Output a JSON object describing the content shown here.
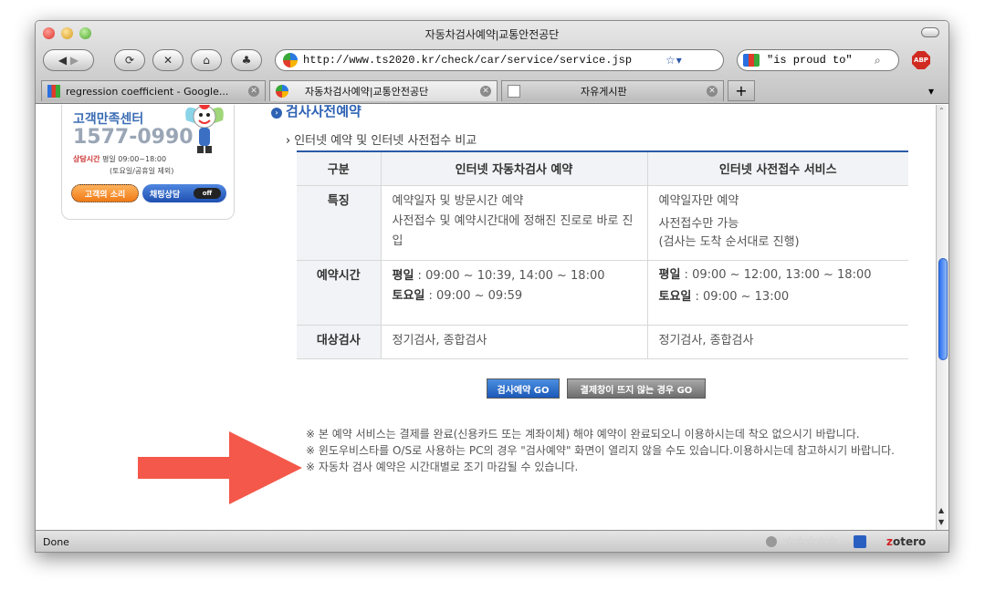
{
  "window": {
    "title": "자동차검사예약|교통안전공단"
  },
  "toolbar": {
    "url": "http://www.ts2020.kr/check/car/service/service.jsp",
    "search_value": "\"is proud to\"",
    "abp_label": "ABP"
  },
  "tabs": [
    {
      "label": "regression coefficient - Google..."
    },
    {
      "label": "자동차검사예약|교통안전공단"
    },
    {
      "label": "자유게시판"
    }
  ],
  "sidebar": {
    "title": "고객만족센터",
    "phone": "1577-0990",
    "hours_label": "상담시간",
    "hours": "평일 09:00~18:00",
    "holiday": "(토요일/공휴일 제외)",
    "voice_button": "고객의 소리",
    "chat_button": "채팅상담",
    "chat_state": "off"
  },
  "page": {
    "section_title": "검사사전예약",
    "subtitle": "인터넷 예약 및 인터넷 사전접수 비교",
    "table": {
      "headers": [
        "구분",
        "인터넷 자동차검사 예약",
        "인터넷 사전접수 서비스"
      ],
      "rows": [
        {
          "label": "특징",
          "col1": [
            "예약일자 및 방문시간 예약",
            "사전접수 및 예약시간대에 정해진 진로로 바로 진입"
          ],
          "col2": [
            "예약일자만 예약",
            "사전접수만 가능",
            "(검사는 도착 순서대로 진행)"
          ]
        },
        {
          "label": "예약시간",
          "col1_weekday_label": "평일",
          "col1_weekday": " : 09:00 ~ 10:39, 14:00 ~ 18:00",
          "col1_sat_label": "토요일",
          "col1_sat": " : 09:00 ~ 09:59",
          "col2_weekday_label": "평일",
          "col2_weekday": " : 09:00 ~ 12:00, 13:00 ~ 18:00",
          "col2_sat_label": "토요일",
          "col2_sat": " : 09:00 ~ 13:00"
        },
        {
          "label": "대상검사",
          "col1": "정기검사, 종합검사",
          "col2": "정기검사, 종합검사"
        }
      ]
    },
    "go_button": "검사예약 GO",
    "go_alt_button": "결제창이 뜨지 않는 경우 GO",
    "notes": [
      "본 예약 서비스는 결제를 완료(신용카드 또는 계좌이체) 해야 예약이 완료되오니 이용하시는데 착오 없으시기 바랍니다.",
      "윈도우비스타를 O/S로 사용하는 PC의 경우 \"검사예약\" 화면이 열리지 않을 수도 있습니다.이용하시는데 참고하시기 바랍니다.",
      "자동차 검사 예약은 시간대별로 조기 마감될 수 있습니다."
    ]
  },
  "status": {
    "text": "Done",
    "zotero_prefix": "z",
    "zotero_rest": "otero"
  },
  "colors": {
    "accent": "#2e62b4",
    "arrow": "#f4584a"
  }
}
